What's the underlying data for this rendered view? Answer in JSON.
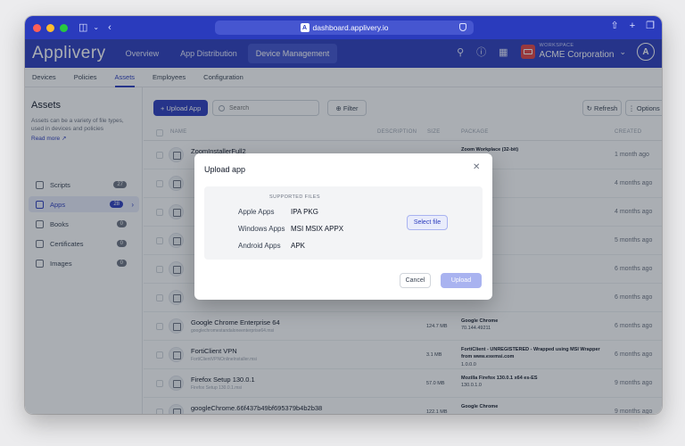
{
  "browser": {
    "url": "dashboard.applivery.io",
    "icons": [
      "sidebar-toggle-icon",
      "chevron-down-icon",
      "back-icon",
      "share-icon",
      "new-tab-icon",
      "tabs-icon"
    ]
  },
  "header": {
    "logo": "Applivery",
    "nav": [
      {
        "label": "Overview",
        "active": false
      },
      {
        "label": "App Distribution",
        "active": false
      },
      {
        "label": "Device Management",
        "active": true
      }
    ],
    "workspace_label": "WORKSPACE",
    "workspace_name": "ACME Corporation",
    "avatar_letter": "A",
    "accent": "#2a3bbd"
  },
  "subnav": [
    {
      "label": "Devices",
      "active": false
    },
    {
      "label": "Policies",
      "active": false
    },
    {
      "label": "Assets",
      "active": true
    },
    {
      "label": "Employees",
      "active": false
    },
    {
      "label": "Configuration",
      "active": false
    }
  ],
  "sidebar": {
    "title": "Assets",
    "description": "Assets can be a variety of file types, used in devices and policies",
    "read_more": "Read more",
    "items": [
      {
        "label": "Scripts",
        "count": "27",
        "active": false
      },
      {
        "label": "Apps",
        "count": "28",
        "active": true
      },
      {
        "label": "Books",
        "count": "0",
        "active": false
      },
      {
        "label": "Certificates",
        "count": "0",
        "active": false
      },
      {
        "label": "Images",
        "count": "0",
        "active": false
      }
    ]
  },
  "toolbar": {
    "upload_label": "+ Upload App",
    "search_placeholder": "Search",
    "filter_label": "Filter",
    "refresh_label": "Refresh",
    "options_label": "Options"
  },
  "table": {
    "columns": [
      "NAME",
      "DESCRIPTION",
      "SIZE",
      "PACKAGE",
      "CREATED"
    ],
    "rows": [
      {
        "name": "ZoomInstallerFull2",
        "file": "",
        "size": "",
        "package": "Zoom Workplace (32-bit)",
        "version": "",
        "created": "1 month ago"
      },
      {
        "name": "",
        "file": "",
        "size": "",
        "package": "",
        "version": "",
        "created": "4 months ago"
      },
      {
        "name": "",
        "file": "",
        "size": "",
        "package": "",
        "version": "",
        "created": "4 months ago"
      },
      {
        "name": "",
        "file": "",
        "size": "",
        "package": "",
        "version": "",
        "created": "5 months ago"
      },
      {
        "name": "",
        "file": "",
        "size": "",
        "package": "",
        "version": "",
        "created": "6 months ago"
      },
      {
        "name": "",
        "file": "",
        "size": "",
        "package": "",
        "version": "",
        "created": "6 months ago"
      },
      {
        "name": "Google Chrome Enterprise 64",
        "file": "googlechromestandaloneenterprise64.msi",
        "size": "124.7 MB",
        "package": "Google Chrome",
        "version": "70.144.49211",
        "created": "6 months ago"
      },
      {
        "name": "FortiClient VPN",
        "file": "FortiClientVPNOnlineInstaller.msi",
        "size": "3.1 MB",
        "package": "FortiClient - UNREGISTERED - Wrapped using MSI Wrapper from www.exemsi.com",
        "version": "1.0.0.0",
        "created": "6 months ago"
      },
      {
        "name": "Firefox Setup 130.0.1",
        "file": "Firefox Setup 130.0.1.msi",
        "size": "57.0 MB",
        "package": "Mozilla Firefox 130.0.1 x64 es-ES",
        "version": "130.0.1.0",
        "created": "9 months ago"
      },
      {
        "name": "googleChrome.66f437b49bf695379b4b2b38",
        "file": "",
        "size": "122.1 MB",
        "package": "Google Chrome",
        "version": "",
        "created": "9 months ago"
      }
    ]
  },
  "modal": {
    "title": "Upload app",
    "supported_label": "SUPPORTED FILES",
    "platforms": [
      {
        "label": "Apple Apps",
        "types": "IPA  PKG"
      },
      {
        "label": "Windows Apps",
        "types": "MSI  MSIX  APPX"
      },
      {
        "label": "Android Apps",
        "types": "APK"
      }
    ],
    "select_label": "Select file",
    "cancel_label": "Cancel",
    "upload_label": "Upload"
  }
}
